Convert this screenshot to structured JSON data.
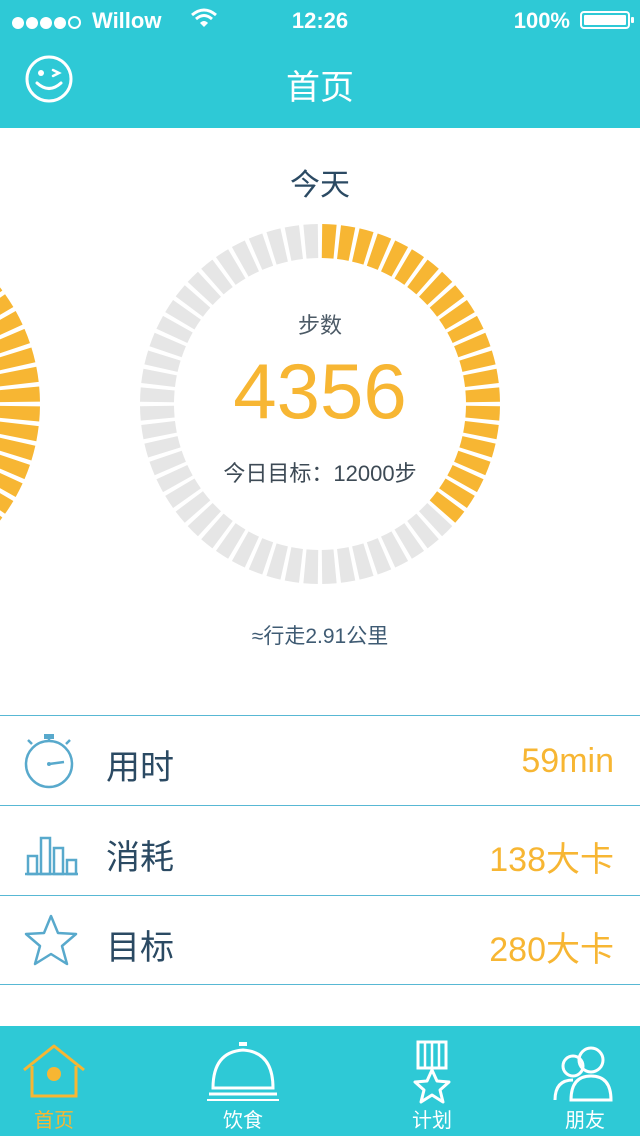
{
  "status_bar": {
    "carrier": "Willow",
    "time": "12:26",
    "battery": "100%"
  },
  "header": {
    "title": "首页",
    "left_icon": "smiley-wink-icon"
  },
  "today_label": "今天",
  "steps": {
    "label": "步数",
    "value": "4356",
    "goal_text": "今日目标：12000步",
    "progress": 0.363,
    "distance_text": "≈行走2.91公里"
  },
  "stats": [
    {
      "label": "用时",
      "value": "59min",
      "icon": "stopwatch-icon"
    },
    {
      "label": "消耗",
      "value": "138大卡",
      "icon": "bar-chart-icon"
    },
    {
      "label": "目标",
      "value": "280大卡",
      "icon": "star-icon"
    }
  ],
  "tabs": [
    {
      "label": "首页",
      "icon": "home-icon",
      "active": true
    },
    {
      "label": "饮食",
      "icon": "food-cloche-icon",
      "active": false
    },
    {
      "label": "计划",
      "icon": "plan-medal-icon",
      "active": false
    },
    {
      "label": "朋友",
      "icon": "friends-icon",
      "active": false
    }
  ],
  "colors": {
    "accent": "#2ec9d6",
    "highlight": "#f7b633",
    "track": "#e6e6e6",
    "divider": "#58b8d4",
    "text": "#2b4a63"
  }
}
